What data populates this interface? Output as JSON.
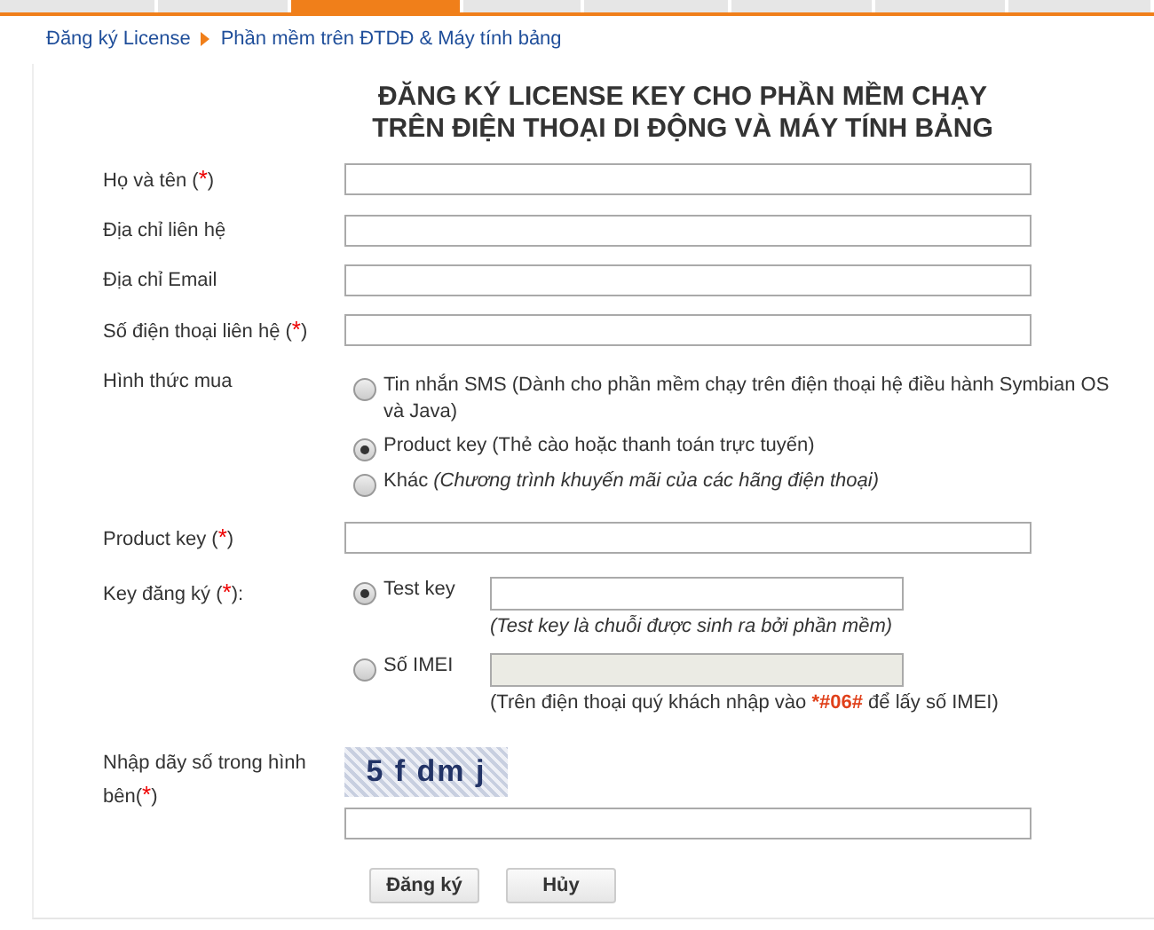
{
  "nav_tabs": [
    {
      "selected": false
    },
    {
      "selected": false
    },
    {
      "selected": true
    },
    {
      "selected": false
    },
    {
      "selected": false
    },
    {
      "selected": false
    },
    {
      "selected": false
    },
    {
      "selected": false
    }
  ],
  "breadcrumb": [
    "Đăng ký License",
    "Phần mềm trên ĐTDĐ & Máy tính bảng"
  ],
  "title": [
    "ĐĂNG KÝ LICENSE KEY CHO PHẦN MỀM CHẠY",
    "TRÊN ĐIỆN THOẠI DI ĐỘNG VÀ MÁY TÍNH BẢNG"
  ],
  "fields": [
    {
      "label": "Họ và tên (",
      "required": "*",
      "label_end": ")"
    },
    {
      "label": "Địa chỉ liên hệ"
    },
    {
      "label": "Địa chỉ Email"
    },
    {
      "label": "Số điện thoại liên hệ (",
      "required": "*",
      "label_end": ")"
    }
  ],
  "purchase": {
    "label": "Hình thức mua",
    "options": [
      {
        "text": "Tin nhắn SMS (Dành cho phần mềm chạy trên điện thoại hệ điều hành Symbian OS và Java)",
        "selected": false
      },
      {
        "text": "Product key (Thẻ cào hoặc thanh toán trực tuyến)",
        "selected": true
      },
      {
        "text": "Khác *(Chương trình khuyến mãi của các hãng điện thoại)*",
        "selected": false
      }
    ]
  },
  "product_key": {
    "label": "Product key (",
    "required": "*",
    "label_end": ")"
  },
  "reg_key": {
    "label": "Key đăng ký (",
    "required": "*",
    "label_end": "):",
    "options": [
      {
        "text": "Test key",
        "selected": true,
        "disabled": false,
        "hint": "(Test key là chuỗi được sinh ra bởi phần mềm)",
        "hint_italic": true
      },
      {
        "text": "Số IMEI",
        "selected": false,
        "disabled": true,
        "hint": "(Trên điện thoại quý khách nhập vào ",
        "hint_code": "*#06#",
        "hint_end": " để lấy số IMEI)",
        "hint_italic": false
      }
    ]
  },
  "captcha": {
    "label": "Nhập dãy số trong hình bên(",
    "required": "*",
    "label_end": ")",
    "code": "5 f dm j"
  },
  "buttons": [
    "Đăng ký",
    "Hủy"
  ]
}
